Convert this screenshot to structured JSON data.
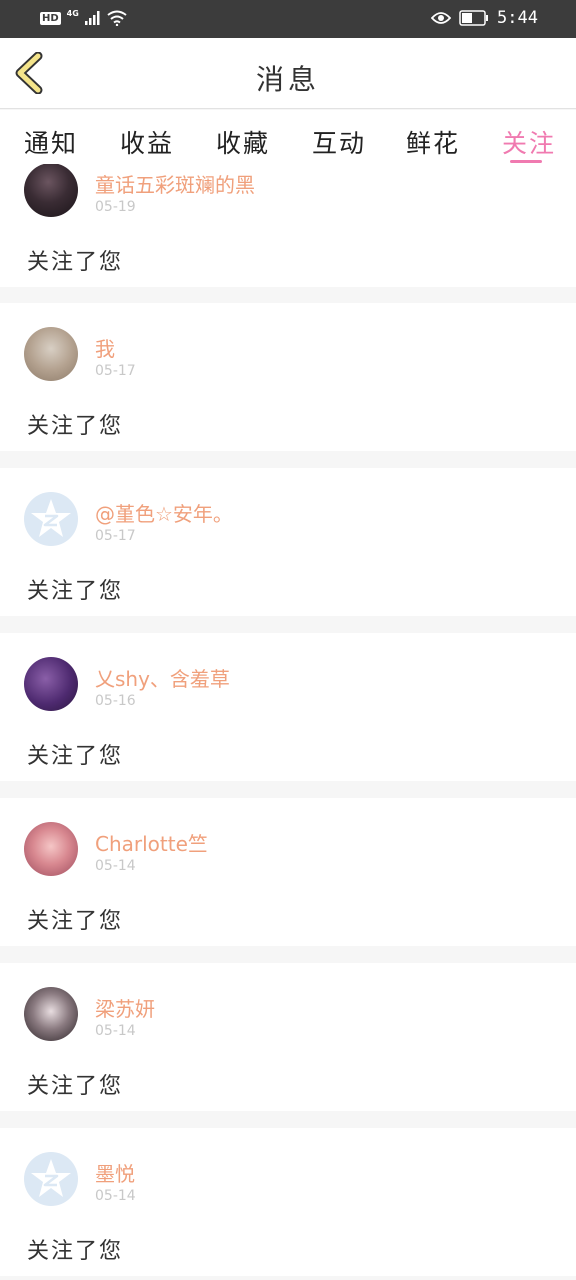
{
  "status_bar": {
    "hd_badge": "HD",
    "network": "4G",
    "time": "5:44",
    "icons": [
      "signal-icon",
      "wifi-icon",
      "eye-icon",
      "battery-icon"
    ]
  },
  "header": {
    "title": "消息",
    "back_icon": "chevron-left-icon"
  },
  "tabs": [
    {
      "label": "通知",
      "active": false
    },
    {
      "label": "收益",
      "active": false
    },
    {
      "label": "收藏",
      "active": false
    },
    {
      "label": "互动",
      "active": false
    },
    {
      "label": "鲜花",
      "active": false
    },
    {
      "label": "关注",
      "active": true
    }
  ],
  "colors": {
    "accent": "#f07ab0",
    "name": "#f0a07c",
    "date": "#c8c8c8",
    "status_bar": "#3c3c3c",
    "default_avatar": "#dce8f4"
  },
  "notifications": [
    {
      "name": "童话五彩斑斓的黑",
      "date": "05-19",
      "action": "关注了您",
      "avatar": "photo-dark"
    },
    {
      "name": "我",
      "date": "05-17",
      "action": "关注了您",
      "avatar": "photo-light"
    },
    {
      "name": "@堇色☆安年。",
      "date": "05-17",
      "action": "关注了您",
      "avatar": "default-avatar-icon"
    },
    {
      "name": "乂shy、含羞草",
      "date": "05-16",
      "action": "关注了您",
      "avatar": "photo-purple"
    },
    {
      "name": "Charlotte竺",
      "date": "05-14",
      "action": "关注了您",
      "avatar": "photo-pink"
    },
    {
      "name": "梁苏妍",
      "date": "05-14",
      "action": "关注了您",
      "avatar": "photo-girl"
    },
    {
      "name": "墨悦",
      "date": "05-14",
      "action": "关注了您",
      "avatar": "default-avatar-icon"
    }
  ]
}
